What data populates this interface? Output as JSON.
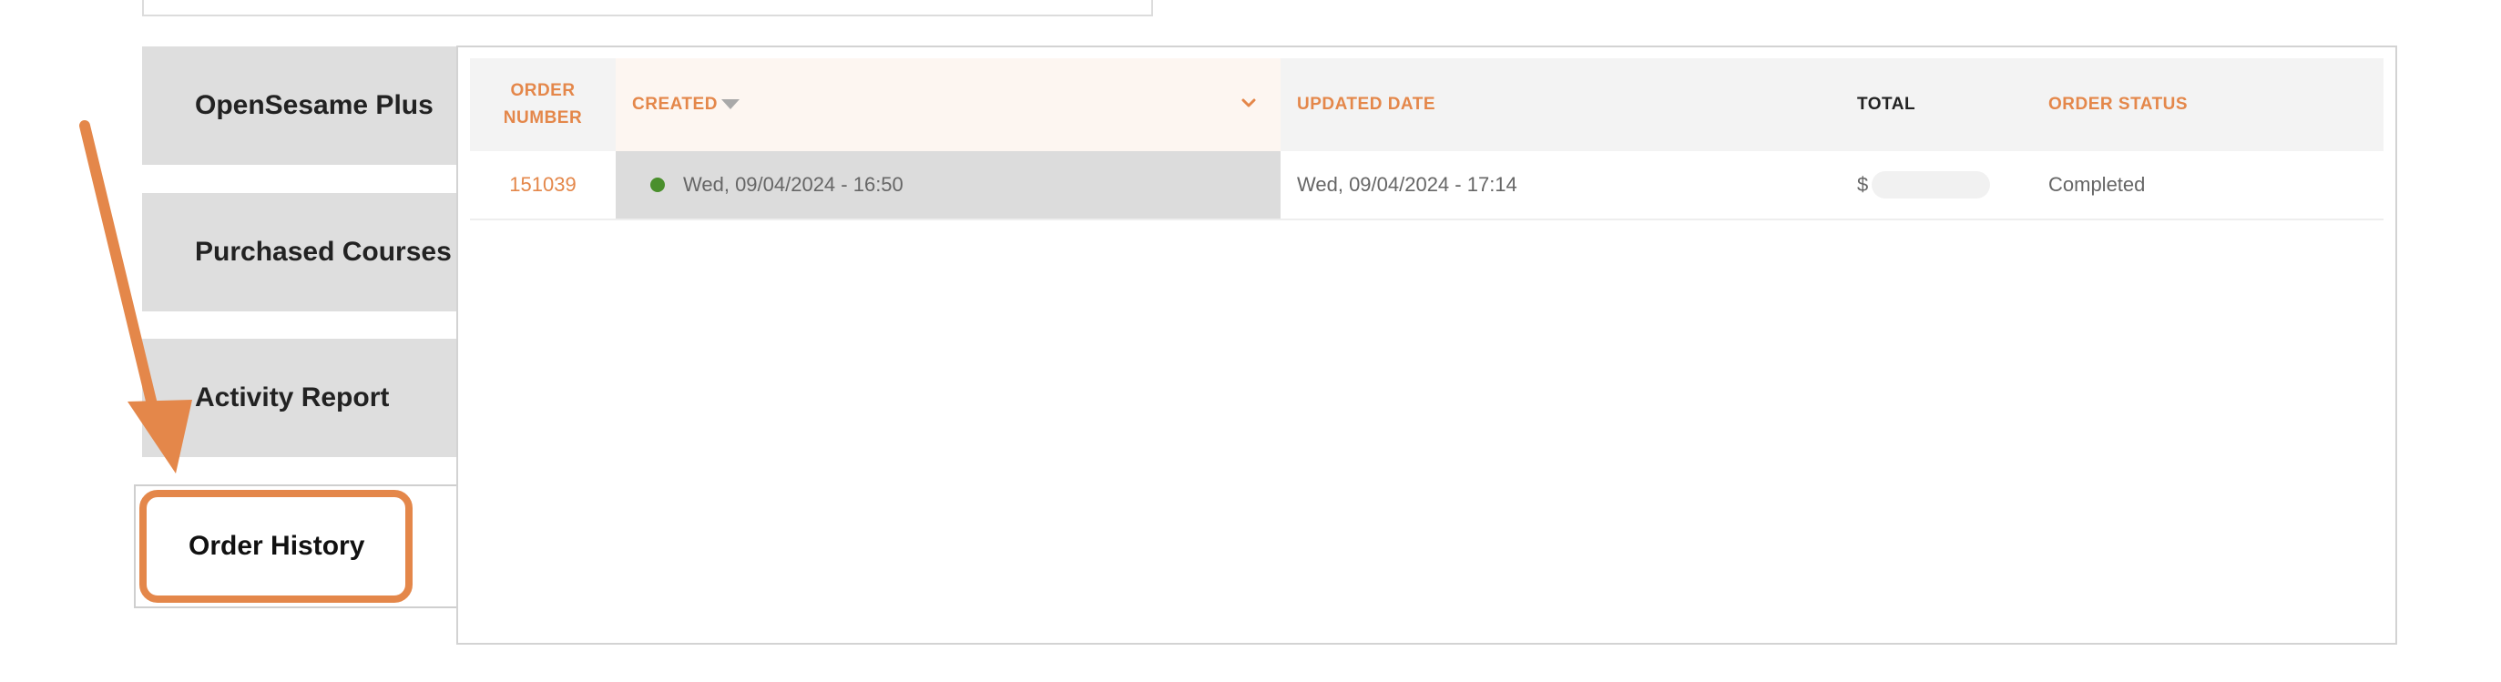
{
  "sidebar": {
    "items": [
      {
        "label": "OpenSesame Plus"
      },
      {
        "label": "Purchased Courses"
      },
      {
        "label": "Activity Report"
      },
      {
        "label": "Order History"
      }
    ]
  },
  "table": {
    "headers": {
      "order_number": "ORDER NUMBER",
      "created": "CREATED",
      "updated": "UPDATED DATE",
      "total": "TOTAL",
      "status": "ORDER STATUS"
    },
    "rows": [
      {
        "order_number": "151039",
        "created": "Wed, 09/04/2024 - 16:50",
        "updated": "Wed, 09/04/2024 - 17:14",
        "total_prefix": "$",
        "status": "Completed"
      }
    ]
  },
  "colors": {
    "accent": "#e4874a",
    "status_dot": "#4a8f2c",
    "tab_bg": "#dedede"
  }
}
